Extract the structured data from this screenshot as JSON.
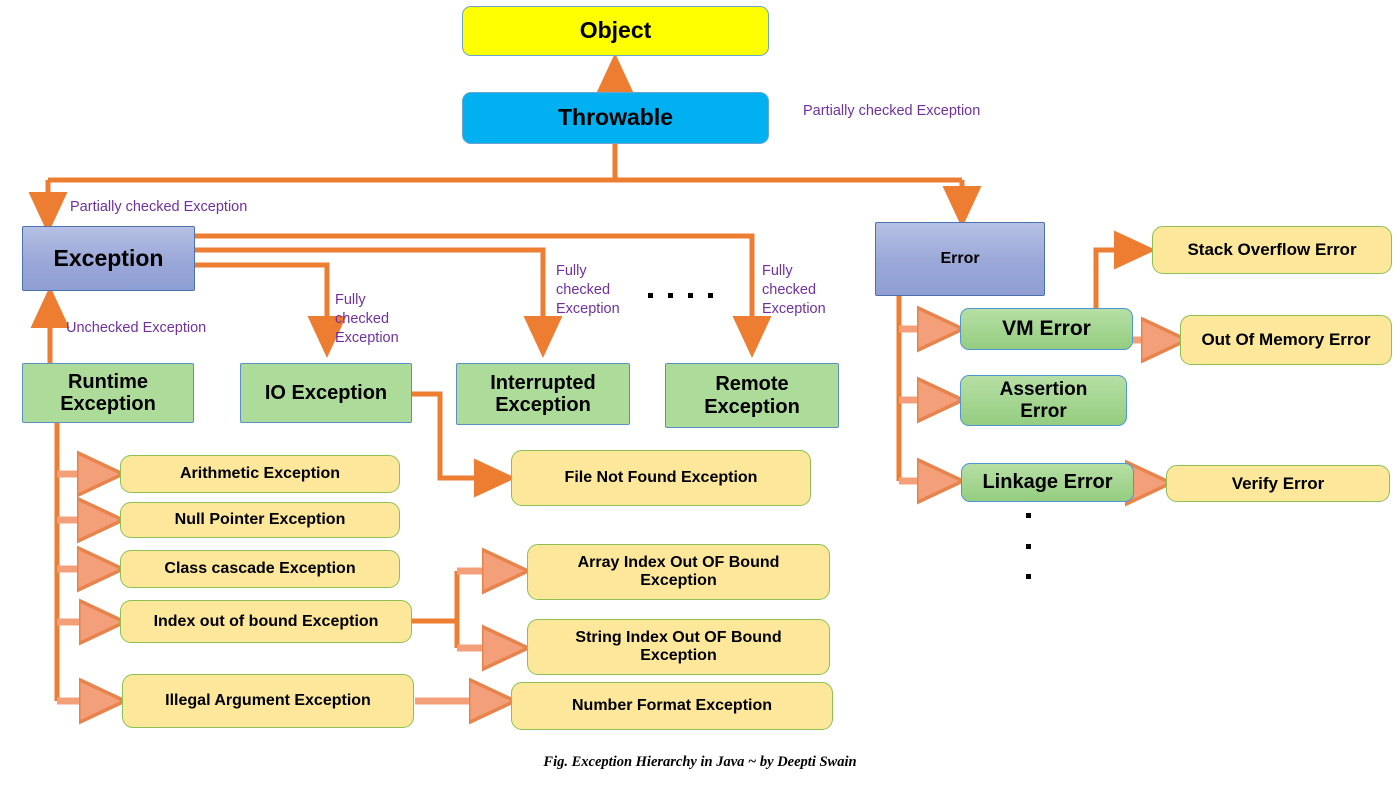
{
  "figure": {
    "caption": "Fig. Exception Hierarchy in Java ~ by Deepti Swain",
    "accent_arrow_color": "#ed7d31",
    "accent_arrow_light": "#f4a582",
    "label_color": "#7030a0"
  },
  "nodes": {
    "object": {
      "label": "Object",
      "color": "#ffff00"
    },
    "throwable": {
      "label": "Throwable",
      "color": "#00b0f0"
    },
    "exception": {
      "label": "Exception",
      "color": "#9aa8d8"
    },
    "error": {
      "label": "Error",
      "color": "#9aa8d8"
    },
    "runtime_exception": {
      "label": "Runtime\nException",
      "color": "#addb9a"
    },
    "io_exception": {
      "label": "IO Exception",
      "color": "#addb9a"
    },
    "interrupted_exception": {
      "label": "Interrupted\nException",
      "color": "#addb9a"
    },
    "remote_exception": {
      "label": "Remote\nException",
      "color": "#addb9a"
    },
    "arithmetic_exception": {
      "label": "Arithmetic Exception",
      "color": "#fce79a"
    },
    "null_pointer_exception": {
      "label": "Null Pointer Exception",
      "color": "#fce79a"
    },
    "class_cascade_exception": {
      "label": "Class cascade Exception",
      "color": "#fce79a"
    },
    "index_out_of_bound_exception": {
      "label": "Index out of bound Exception",
      "color": "#fce79a"
    },
    "illegal_argument_exception": {
      "label": "Illegal Argument Exception",
      "color": "#fce79a"
    },
    "file_not_found_exception": {
      "label": "File Not Found Exception",
      "color": "#fce79a"
    },
    "array_index_out_of_bound_exception": {
      "label": "Array Index Out OF Bound\nException",
      "color": "#fce79a"
    },
    "string_index_out_of_bound_exception": {
      "label": "String Index Out OF Bound\nException",
      "color": "#fce79a"
    },
    "number_format_exception": {
      "label": "Number Format Exception",
      "color": "#fce79a"
    },
    "vm_error": {
      "label": "VM Error",
      "color": "#94cd80"
    },
    "assertion_error": {
      "label": "Assertion\nError",
      "color": "#94cd80"
    },
    "linkage_error": {
      "label": "Linkage Error",
      "color": "#94cd80"
    },
    "stack_overflow_error": {
      "label": "Stack Overflow Error",
      "color": "#fce79a"
    },
    "out_of_memory_error": {
      "label": "Out Of Memory Error",
      "color": "#fce79a"
    },
    "verify_error": {
      "label": "Verify Error",
      "color": "#fce79a"
    }
  },
  "edge_labels": {
    "partially_checked_top": "Partially checked Exception",
    "partially_checked_left": "Partially checked Exception",
    "unchecked": "Unchecked Exception",
    "fully_checked_io": "Fully\nchecked\nException",
    "fully_checked_interrupted": "Fully\nchecked\nException",
    "fully_checked_remote": "Fully\nchecked\nException"
  },
  "ellipsis": {
    "horizontal_dots": 4,
    "vertical_dots": 3
  }
}
